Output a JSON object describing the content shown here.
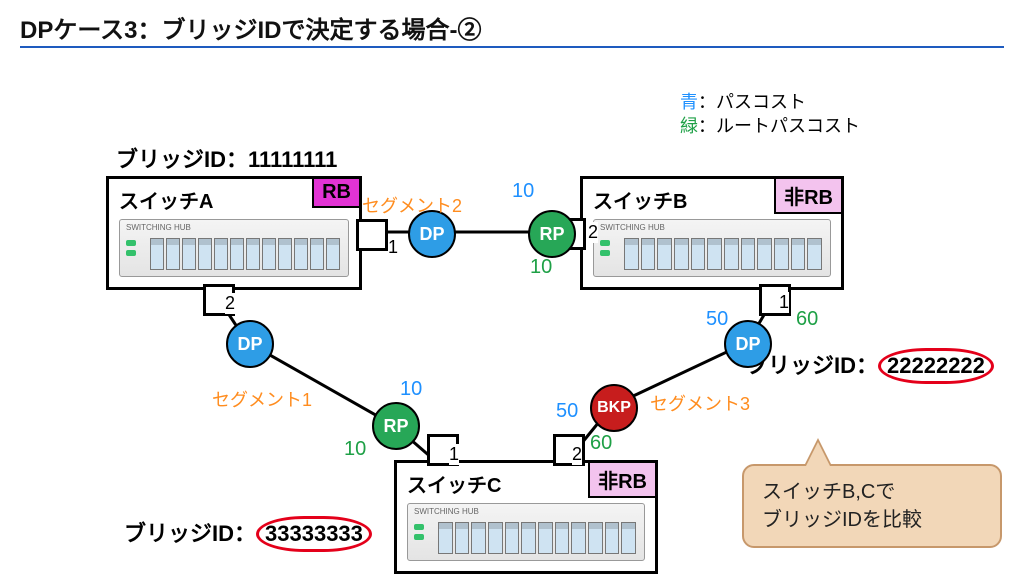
{
  "title": "DPケース3：ブリッジIDで決定する場合-②",
  "legend": {
    "blue_label": "青",
    "blue_text": "：パスコスト",
    "green_label": "緑",
    "green_text": "：ルートパスコスト"
  },
  "bridge_ids": {
    "a_label": "ブリッジID：11111111",
    "b_prefix": "ブリッジID：",
    "b_value": "22222222",
    "c_prefix": "ブリッジID：",
    "c_value": "33333333"
  },
  "switches": {
    "a": {
      "name": "スイッチA",
      "tag": "RB",
      "hub": "SWITCHING HUB"
    },
    "b": {
      "name": "スイッチB",
      "tag": "非RB",
      "hub": "SWITCHING HUB"
    },
    "c": {
      "name": "スイッチC",
      "tag": "非RB",
      "hub": "SWITCHING HUB"
    }
  },
  "segments": {
    "s1": "セグメント1",
    "s2": "セグメント2",
    "s3": "セグメント3"
  },
  "roles": {
    "dp": "DP",
    "rp": "RP",
    "bkp": "BKP"
  },
  "ports": {
    "a1": "1",
    "a2": "2",
    "b1": "1",
    "b2": "2",
    "c1": "1",
    "c2": "2"
  },
  "costs": {
    "seg2_blue": "10",
    "seg2_green": "10",
    "seg1_blue": "10",
    "seg1_green": "10",
    "seg3_b_blue": "50",
    "seg3_b_green": "60",
    "seg3_c_blue": "50",
    "seg3_c_green": "60"
  },
  "callout": {
    "line1": "スイッチB,Cで",
    "line2": "ブリッジIDを比較"
  }
}
